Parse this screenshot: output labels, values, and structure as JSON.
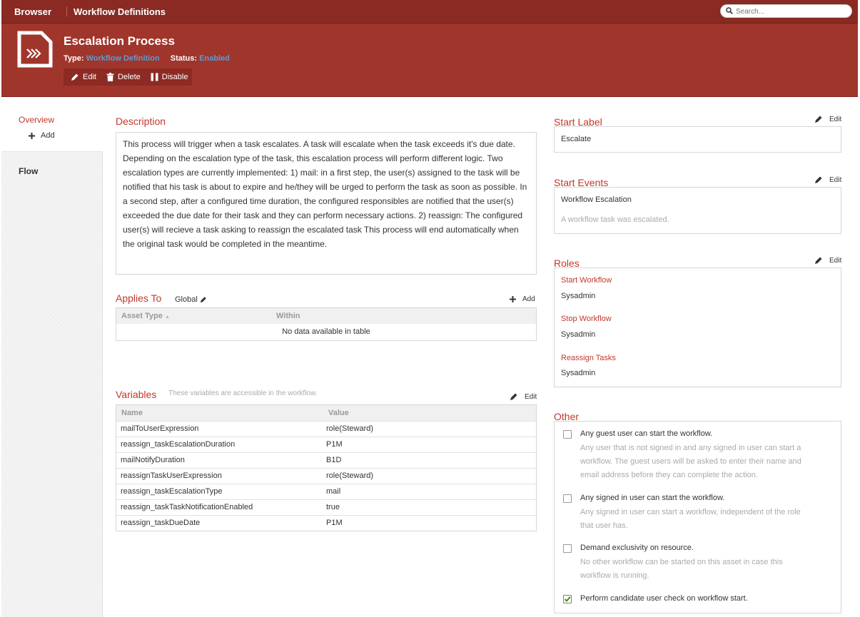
{
  "topbar": {
    "brand": "Browser",
    "breadcrumb": "Workflow Definitions",
    "search_placeholder": "Search..."
  },
  "header": {
    "title": "Escalation Process",
    "type_label": "Type:",
    "type_value": "Workflow Definition",
    "status_label": "Status:",
    "status_value": "Enabled",
    "actions": {
      "edit": "Edit",
      "delete": "Delete",
      "disable": "Disable"
    }
  },
  "leftnav": {
    "overview": "Overview",
    "add": "Add",
    "flow": "Flow"
  },
  "description": {
    "title": "Description",
    "text": "This process will trigger when a task escalates. A task will escalate when the task exceeds it's due date. Depending on the escalation type of the task, this escalation process will perform different logic. Two escalation types are currently implemented: 1) mail: in a first step, the user(s) assigned to the task will be notified that his task is about to expire and he/they will be urged to perform the task as soon as possible. In a second step, after a configured time duration, the configured responsibles are notified that the user(s) exceeded the due date for their task and they can perform necessary actions. 2) reassign: The configured user(s) will recieve a task asking to reassign the escalated task This process will end automatically when the original task would be completed in the meantime."
  },
  "applies_to": {
    "title": "Applies To",
    "scope": "Global",
    "add": "Add",
    "columns": [
      "Asset Type",
      "Within"
    ],
    "empty": "No data available in table"
  },
  "variables": {
    "title": "Variables",
    "hint": "These variables are accessible in the workflow.",
    "edit": "Edit",
    "columns": [
      "Name",
      "Value"
    ],
    "rows": [
      {
        "name": "mailToUserExpression",
        "value": "role(Steward)"
      },
      {
        "name": "reassign_taskEscalationDuration",
        "value": "P1M"
      },
      {
        "name": "mailNotifyDuration",
        "value": "B1D"
      },
      {
        "name": "reassignTaskUserExpression",
        "value": "role(Steward)"
      },
      {
        "name": "reassign_taskEscalationType",
        "value": "mail"
      },
      {
        "name": "reassign_taskTaskNotificationEnabled",
        "value": "true"
      },
      {
        "name": "reassign_taskDueDate",
        "value": "P1M"
      }
    ]
  },
  "start_label": {
    "title": "Start Label",
    "edit": "Edit",
    "value": "Escalate"
  },
  "start_events": {
    "title": "Start Events",
    "edit": "Edit",
    "event_name": "Workflow Escalation",
    "event_desc": "A workflow task was escalated."
  },
  "roles": {
    "title": "Roles",
    "edit": "Edit",
    "items": [
      {
        "label": "Start Workflow",
        "value": "Sysadmin"
      },
      {
        "label": "Stop Workflow",
        "value": "Sysadmin"
      },
      {
        "label": "Reassign Tasks",
        "value": "Sysadmin"
      }
    ]
  },
  "other": {
    "title": "Other",
    "options": [
      {
        "label": "Any guest user can start the workflow.",
        "checked": false,
        "desc": [
          "Any user that is not signed in and any signed in user can start a",
          "workflow. The guest users will be asked to enter their name and",
          "email address before they can complete the action."
        ]
      },
      {
        "label": "Any signed in user can start the workflow.",
        "checked": false,
        "desc": [
          "Any signed in user can start a workflow, independent of the role",
          "that user has."
        ]
      },
      {
        "label": "Demand exclusivity on resource.",
        "checked": false,
        "desc": [
          "No other workflow can be started on this asset in case this",
          "workflow is running."
        ]
      },
      {
        "label": "Perform candidate user check on workflow start.",
        "checked": true,
        "desc": []
      }
    ]
  },
  "colors": {
    "topbar": "#8a2a22",
    "header": "#a0352c",
    "accent": "#c0392b",
    "link_blue": "#5b9bd1",
    "check_green": "#6a9a3a"
  }
}
